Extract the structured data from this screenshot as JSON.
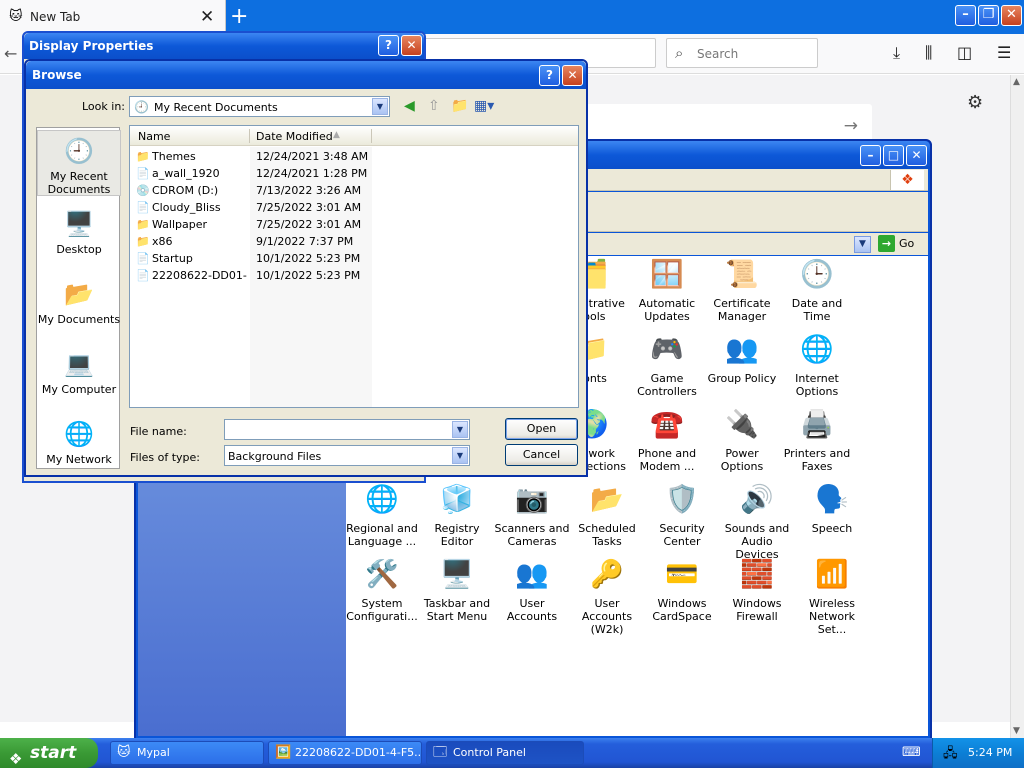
{
  "firefox": {
    "tab_title": "New Tab",
    "search_placeholder": "Search"
  },
  "control_panel": {
    "address_go": "Go",
    "icons": [
      {
        "label": "Administrative Tools",
        "display": "ministrative\nTools",
        "icon": "admin-tools-icon",
        "glyph": "🗂️"
      },
      {
        "label": "Automatic Updates",
        "display": "Automatic\nUpdates",
        "icon": "automatic-updates-icon",
        "glyph": "🪟"
      },
      {
        "label": "Certificate Manager",
        "display": "Certificate\nManager",
        "icon": "certificate-icon",
        "glyph": "📜"
      },
      {
        "label": "Date and Time",
        "display": "Date and Time",
        "icon": "clock-icon",
        "glyph": "🕒"
      },
      {
        "label": "Fonts",
        "display": "Fonts",
        "icon": "fonts-folder-icon",
        "glyph": "📁"
      },
      {
        "label": "Game Controllers",
        "display": "Game\nControllers",
        "icon": "gamepad-icon",
        "glyph": "🎮"
      },
      {
        "label": "Group Policy",
        "display": "Group Policy",
        "icon": "group-policy-icon",
        "glyph": "👥"
      },
      {
        "label": "Internet Options",
        "display": "Internet\nOptions",
        "icon": "globe-icon",
        "glyph": "🌐"
      },
      {
        "label": "Network Connections",
        "display": "Network\nConnections",
        "icon": "network-globe-icon",
        "glyph": "🌍"
      },
      {
        "label": "Phone and Modem ...",
        "display": "Phone and\nModem ...",
        "icon": "phone-icon",
        "glyph": "☎️"
      },
      {
        "label": "Power Options",
        "display": "Power Options",
        "icon": "power-icon",
        "glyph": "🔌"
      },
      {
        "label": "Printers and Faxes",
        "display": "Printers and\nFaxes",
        "icon": "printer-icon",
        "glyph": "🖨️"
      },
      {
        "label": "Regional and Language ...",
        "display": "Regional and\nLanguage ...",
        "icon": "regional-globe-icon",
        "glyph": "🌐"
      },
      {
        "label": "Registry Editor",
        "display": "Registry Editor",
        "icon": "registry-icon",
        "glyph": "🧊"
      },
      {
        "label": "Scanners and Cameras",
        "display": "Scanners and\nCameras",
        "icon": "scanner-icon",
        "glyph": "📷"
      },
      {
        "label": "Scheduled Tasks",
        "display": "Scheduled\nTasks",
        "icon": "scheduled-tasks-icon",
        "glyph": "📂"
      },
      {
        "label": "Security Center",
        "display": "Security\nCenter",
        "icon": "shield-icon",
        "glyph": "🛡️"
      },
      {
        "label": "Sounds and Audio Devices",
        "display": "Sounds and\nAudio Devices",
        "icon": "speaker-icon",
        "glyph": "🔊"
      },
      {
        "label": "Speech",
        "display": "Speech",
        "icon": "speech-icon",
        "glyph": "🗣️"
      },
      {
        "label": "System Configurati...",
        "display": "System\nConfigurati...",
        "icon": "system-config-icon",
        "glyph": "🛠️"
      },
      {
        "label": "Taskbar and Start Menu",
        "display": "Taskbar and\nStart Menu",
        "icon": "taskbar-icon",
        "glyph": "🖥️"
      },
      {
        "label": "User Accounts",
        "display": "User Accounts",
        "icon": "users-icon",
        "glyph": "👥"
      },
      {
        "label": "User Accounts (W2k)",
        "display": "User Accounts\n(W2k)",
        "icon": "user-key-icon",
        "glyph": "🔑"
      },
      {
        "label": "Windows CardSpace",
        "display": "Windows\nCardSpace",
        "icon": "cardspace-icon",
        "glyph": "💳"
      },
      {
        "label": "Windows Firewall",
        "display": "Windows\nFirewall",
        "icon": "firewall-icon",
        "glyph": "🧱"
      },
      {
        "label": "Wireless Network Set...",
        "display": "Wireless\nNetwork Set...",
        "icon": "wireless-icon",
        "glyph": "📶"
      }
    ]
  },
  "display_properties": {
    "title": "Display Properties"
  },
  "browse_dialog": {
    "title": "Browse",
    "look_in_label": "Look in:",
    "look_in_value": "My Recent Documents",
    "places": [
      {
        "label": "My Recent Documents",
        "display": "My Recent\nDocuments",
        "icon": "recent-documents-icon",
        "glyph": "🕘"
      },
      {
        "label": "Desktop",
        "display": "Desktop",
        "icon": "desktop-icon",
        "glyph": "🖥️"
      },
      {
        "label": "My Documents",
        "display": "My Documents",
        "icon": "my-documents-icon",
        "glyph": "📂"
      },
      {
        "label": "My Computer",
        "display": "My Computer",
        "icon": "my-computer-icon",
        "glyph": "💻"
      },
      {
        "label": "My Network",
        "display": "My Network",
        "icon": "my-network-icon",
        "glyph": "🌐"
      }
    ],
    "columns": {
      "name": "Name",
      "date_modified": "Date Modified"
    },
    "files": [
      {
        "name": "Themes",
        "date": "12/24/2021 3:48 AM",
        "icon": "folder-shortcut-icon"
      },
      {
        "name": "a_wall_1920",
        "date": "12/24/2021 1:28 PM",
        "icon": "file-shortcut-icon"
      },
      {
        "name": "CDROM (D:)",
        "date": "7/13/2022 3:26 AM",
        "icon": "drive-shortcut-icon"
      },
      {
        "name": "Cloudy_Bliss",
        "date": "7/25/2022 3:01 AM",
        "icon": "file-shortcut-icon"
      },
      {
        "name": "Wallpaper",
        "date": "7/25/2022 3:01 AM",
        "icon": "folder-shortcut-icon"
      },
      {
        "name": "x86",
        "date": "9/1/2022 7:37 PM",
        "icon": "folder-shortcut-icon"
      },
      {
        "name": "Startup",
        "date": "10/1/2022 5:23 PM",
        "icon": "file-shortcut-icon"
      },
      {
        "name": "22208622-DD01-...",
        "date": "10/1/2022 5:23 PM",
        "icon": "file-shortcut-icon"
      }
    ],
    "file_name_label": "File name:",
    "file_name_value": "",
    "files_of_type_label": "Files of type:",
    "files_of_type_value": "Background Files",
    "open_button": "Open",
    "cancel_button": "Cancel"
  },
  "taskbar": {
    "start_label": "start",
    "tasks": [
      {
        "label": "Mypal",
        "icon": "mypal-icon"
      },
      {
        "label": "22208622-DD01-4-F5...",
        "icon": "image-icon"
      },
      {
        "label": "Control Panel",
        "icon": "control-panel-icon"
      }
    ],
    "clock": "5:24 PM"
  }
}
